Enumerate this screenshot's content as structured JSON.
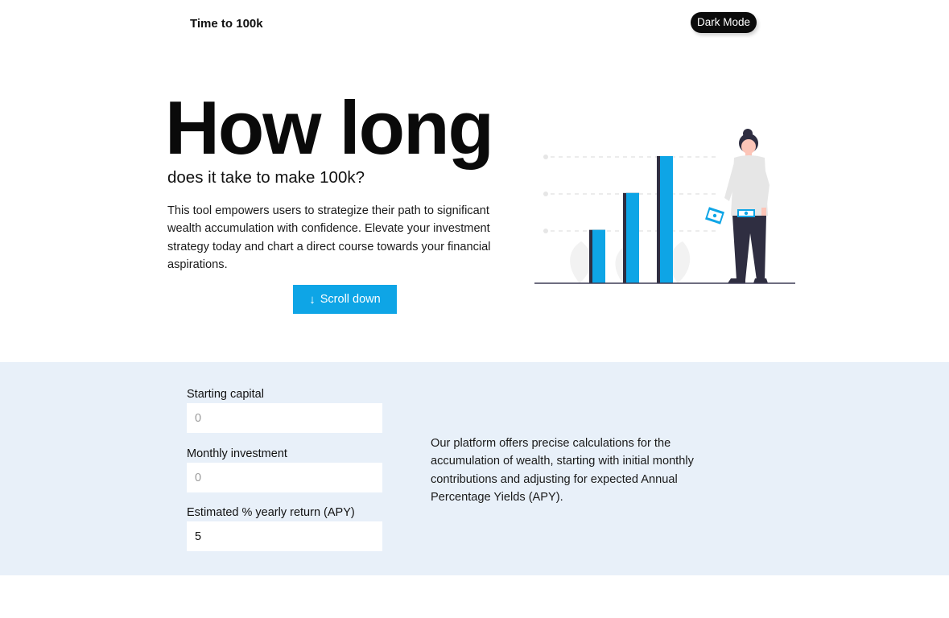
{
  "header": {
    "brand": "Time to 100k",
    "dark_mode_label": "Dark Mode"
  },
  "hero": {
    "title": "How long",
    "subtitle": "does it take to make 100k?",
    "description": "This tool empowers users to strategize their path to significant wealth accumulation with confidence. Elevate your investment strategy today and chart a direct course towards your financial aspirations.",
    "scroll_label": "Scroll down",
    "scroll_icon": "arrow-down-icon"
  },
  "illustration": {
    "bar_levels": [
      0.42,
      0.71,
      1.0
    ],
    "colors": {
      "bar": "#0ea5e6",
      "bar_shadow": "#2f2e41",
      "guide": "#e6e6e6",
      "leaf": "#f2f2f2",
      "shirt": "#e6e6e6",
      "pants": "#2f2e41",
      "skin": "#fcc5b8",
      "hair": "#2f2e41",
      "bill": "#0ea5e6"
    }
  },
  "calculator": {
    "fields": [
      {
        "label": "Starting capital",
        "value": "",
        "placeholder": "0"
      },
      {
        "label": "Monthly investment",
        "value": "",
        "placeholder": "0"
      },
      {
        "label": "Estimated % yearly return (APY)",
        "value": "5",
        "placeholder": ""
      }
    ],
    "description": "Our platform offers precise calculations for the accumulation of wealth, starting with initial monthly contributions and adjusting for expected Annual Percentage Yields (APY)."
  },
  "colors": {
    "accent": "#0ea5e6",
    "section_bg": "#e8f0f9",
    "toggle_bg": "#0b0b0b"
  }
}
